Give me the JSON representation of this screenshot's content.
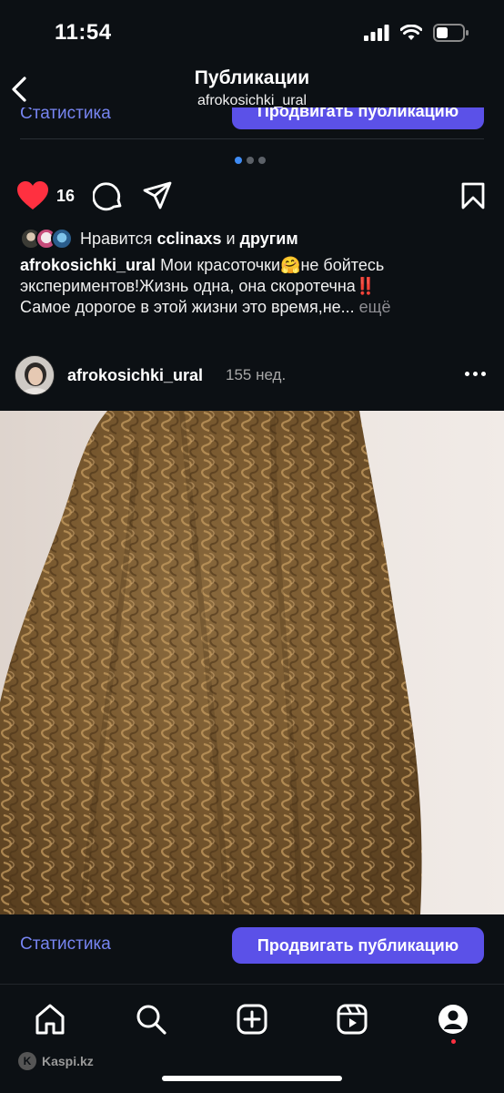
{
  "status_bar": {
    "time": "11:54"
  },
  "header": {
    "title": "Публикации",
    "subtitle": "afrokosichki_ural"
  },
  "previous_post": {
    "stats_label": "Статистика",
    "promote_label": "Продвигать публикацию"
  },
  "carousel": {
    "pages": 3,
    "active": 1
  },
  "actions": {
    "like_count": "16",
    "icons": [
      "heart-filled-icon",
      "comment-icon",
      "share-icon",
      "bookmark-icon"
    ],
    "like_color": "#ff3040"
  },
  "likes": {
    "prefix": "Нравится",
    "user": "cclinaxs",
    "connector": "и",
    "others": "другим"
  },
  "caption": {
    "user": "afrokosichki_ural",
    "part1": "Мои красоточки",
    "emoji1": "🤗",
    "part2": "не бойтесь экспериментов!Жизнь одна, она скоротечна",
    "emoji2": "‼️",
    "part3": "Самое дорогое в этой жизни это время,не...",
    "more": "ещё"
  },
  "post": {
    "user": "afrokosichki_ural",
    "time": "155 нед."
  },
  "action_bar": {
    "stats_label": "Статистика",
    "promote_label": "Продвигать публикацию",
    "accent": "#5b51e8",
    "link_color": "#7785f2"
  },
  "tab_bar": {
    "tabs": [
      "home-icon",
      "search-icon",
      "create-icon",
      "reels-icon",
      "profile-icon"
    ]
  },
  "watermark": {
    "text": "Kaspi.kz"
  }
}
